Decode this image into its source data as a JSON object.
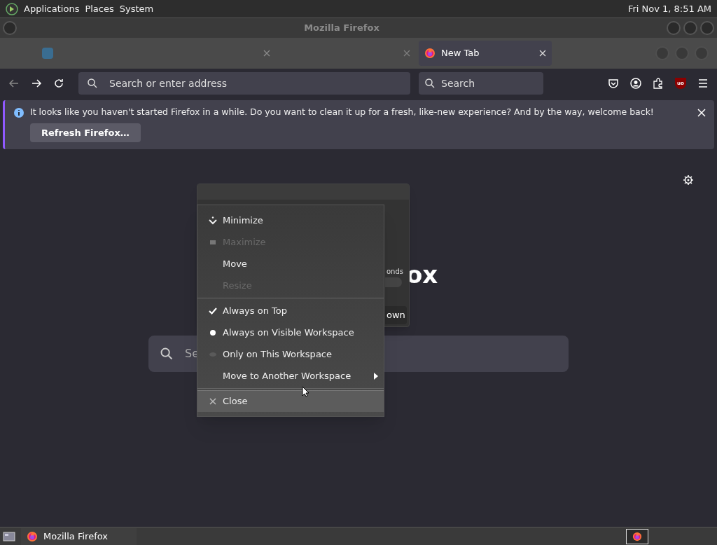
{
  "top_panel": {
    "menus": [
      "Applications",
      "Places",
      "System"
    ],
    "clock": "Fri Nov 1, 8:51 AM"
  },
  "window": {
    "title": "Mozilla Firefox"
  },
  "tabs": [
    {
      "label": "New Tab",
      "selected": true
    }
  ],
  "toolbar": {
    "address_placeholder": "Search or enter address",
    "search_placeholder": "Search",
    "addon_badge": "uo"
  },
  "notification": {
    "message": "It looks like you haven't started Firefox in a while. Do you want to clean it up for a fresh, like-new experience? And by the way, welcome back!",
    "button": "Refresh Firefox…"
  },
  "newtab": {
    "logo_fragment": "ox",
    "search_fragment": "Se"
  },
  "dialog": {
    "label_fragment": "onds",
    "button_fragment": "own"
  },
  "context_menu": {
    "sections": [
      [
        {
          "kind": "minimize",
          "label": "Minimize",
          "disabled": false,
          "highlighted": false
        },
        {
          "kind": "maximize",
          "label": "Maximize",
          "disabled": true,
          "highlighted": false
        },
        {
          "kind": "plain",
          "label": "Move",
          "disabled": false,
          "highlighted": false
        },
        {
          "kind": "plain",
          "label": "Resize",
          "disabled": true,
          "highlighted": false
        }
      ],
      [
        {
          "kind": "check",
          "label": "Always on Top",
          "checked": true,
          "disabled": false,
          "highlighted": false
        },
        {
          "kind": "radio",
          "label": "Always on Visible Workspace",
          "checked": true,
          "disabled": false,
          "highlighted": false
        },
        {
          "kind": "radio",
          "label": "Only on This Workspace",
          "checked": false,
          "disabled": false,
          "highlighted": false
        },
        {
          "kind": "submenu",
          "label": "Move to Another Workspace",
          "disabled": false,
          "highlighted": false
        }
      ],
      [
        {
          "kind": "close",
          "label": "Close",
          "disabled": false,
          "highlighted": true
        }
      ]
    ]
  },
  "taskbar": {
    "tasks": [
      {
        "label": "Mozilla Firefox",
        "selected": false
      }
    ]
  }
}
